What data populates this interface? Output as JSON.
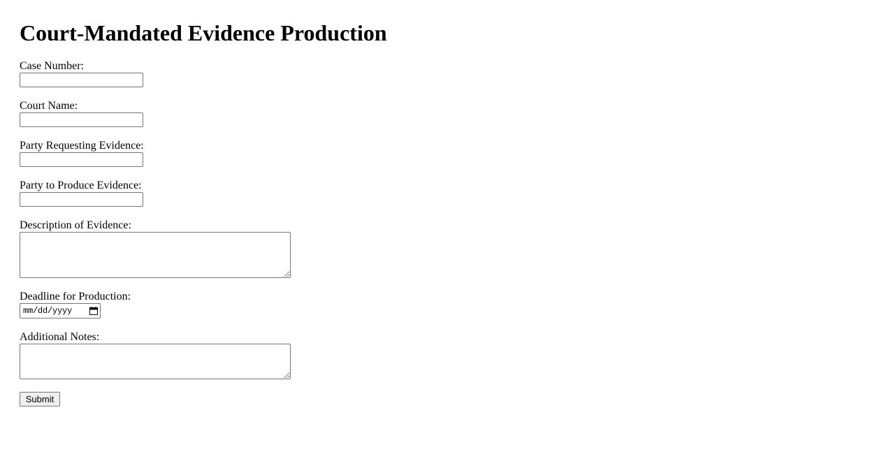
{
  "page": {
    "title": "Court-Mandated Evidence Production"
  },
  "form": {
    "case_number": {
      "label": "Case Number:",
      "value": ""
    },
    "court_name": {
      "label": "Court Name:",
      "value": ""
    },
    "party_requesting": {
      "label": "Party Requesting Evidence:",
      "value": ""
    },
    "party_to_produce": {
      "label": "Party to Produce Evidence:",
      "value": ""
    },
    "description": {
      "label": "Description of Evidence:",
      "value": ""
    },
    "deadline": {
      "label": "Deadline for Production:",
      "placeholder": "mm/dd/yyyy",
      "icon": "calendar-icon"
    },
    "notes": {
      "label": "Additional Notes:",
      "value": ""
    },
    "submit_label": "Submit"
  }
}
